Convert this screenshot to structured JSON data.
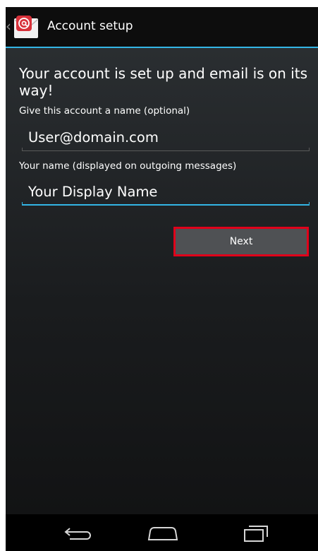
{
  "action_bar": {
    "title": "Account setup",
    "app_icon": "email-at-icon",
    "up_icon": "up-caret-icon"
  },
  "setup": {
    "headline": "Your account is set up and email is on its way!",
    "account_name_label": "Give this account a name (optional)",
    "account_name_value": "User@domain.com",
    "your_name_label": "Your name (displayed on outgoing messages)",
    "your_name_value": "Your Display Name",
    "next_label": "Next"
  },
  "nav_bar": {
    "back_icon": "back-icon",
    "home_icon": "home-icon",
    "recents_icon": "recent-apps-icon"
  },
  "colors": {
    "accent": "#33b5e5",
    "highlight": "#e0001a",
    "icon_red": "#d8313a"
  }
}
